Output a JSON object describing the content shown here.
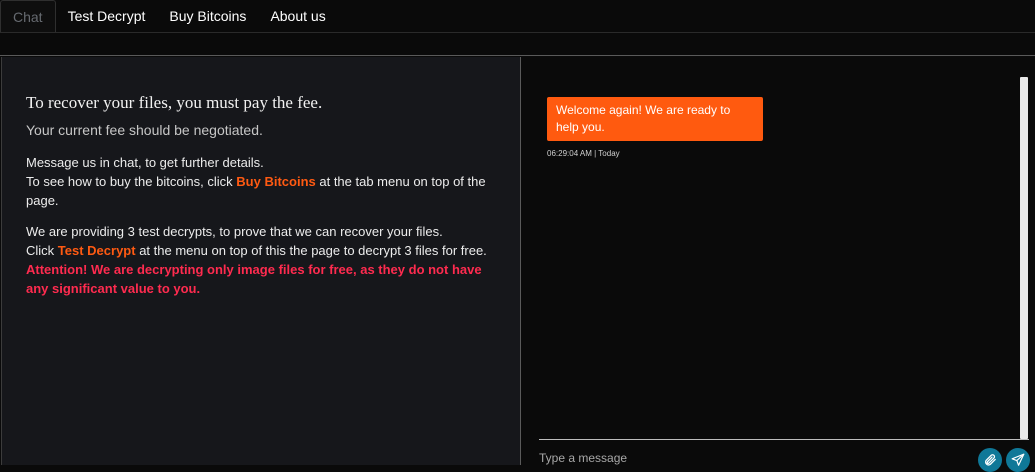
{
  "nav": {
    "tabs": [
      {
        "label": "Chat"
      },
      {
        "label": "Test Decrypt"
      },
      {
        "label": "Buy Bitcoins"
      },
      {
        "label": "About us"
      }
    ]
  },
  "info": {
    "heading": "To recover your files, you must pay the fee.",
    "subheading": "Your current fee should be negotiated.",
    "p1_line1": "Message us in chat, to get further details.",
    "p1_line2_pre": "To see how to buy the bitcoins, click ",
    "p1_link": "Buy Bitcoins",
    "p1_line2_post": " at the tab menu on top of the page.",
    "p2_line1": "We are providing 3 test decrypts, to prove that we can recover your files.",
    "p2_line2_pre": "Click ",
    "p2_link": "Test Decrypt",
    "p2_line2_post": " at the menu on top of this the page to decrypt 3 files for free.",
    "warning": "Attention! We are decrypting only image files for free, as they do not have any significant value to you."
  },
  "chat": {
    "messages": [
      {
        "text": "Welcome again! We are ready to help you.",
        "time": "06:29:04 AM | Today"
      }
    ],
    "input_placeholder": "Type a message",
    "icons": {
      "attach": "paperclip-icon",
      "send": "send-icon"
    }
  },
  "colors": {
    "accent": "#ff5a12",
    "warning": "#ff2b4f",
    "button": "#0f7898",
    "bubble": "#ff5a0f"
  }
}
